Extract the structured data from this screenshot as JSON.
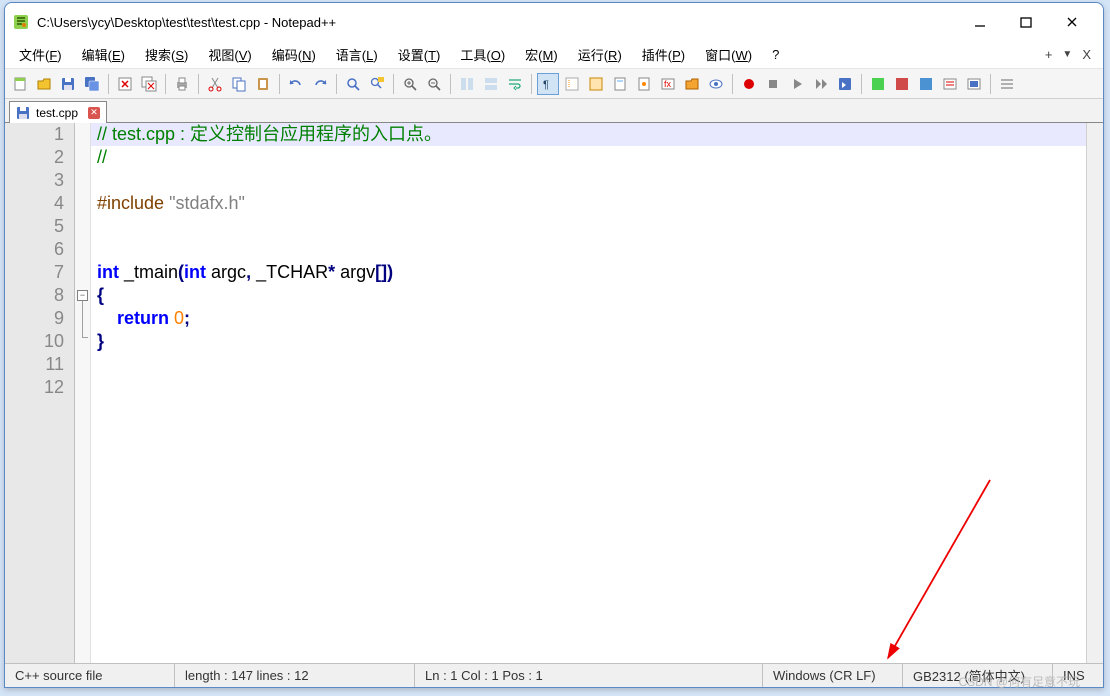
{
  "window": {
    "title": "C:\\Users\\ycy\\Desktop\\test\\test\\test.cpp - Notepad++"
  },
  "menus": [
    {
      "label": "文件",
      "key": "F"
    },
    {
      "label": "编辑",
      "key": "E"
    },
    {
      "label": "搜索",
      "key": "S"
    },
    {
      "label": "视图",
      "key": "V"
    },
    {
      "label": "编码",
      "key": "N"
    },
    {
      "label": "语言",
      "key": "L"
    },
    {
      "label": "设置",
      "key": "T"
    },
    {
      "label": "工具",
      "key": "O"
    },
    {
      "label": "宏",
      "key": "M"
    },
    {
      "label": "运行",
      "key": "R"
    },
    {
      "label": "插件",
      "key": "P"
    },
    {
      "label": "窗口",
      "key": "W"
    },
    {
      "label": "?",
      "key": ""
    }
  ],
  "menuRight": {
    "plus": "+",
    "down": "▼",
    "x": "X"
  },
  "tab": {
    "name": "test.cpp"
  },
  "lineCount": 12,
  "code": {
    "l1_cmt": "// test.cpp : 定义控制台应用程序的入口点。",
    "l2_cmt": "//",
    "l4_pre": "#include ",
    "l4_str": "\"stdafx.h\"",
    "l7_kw1": "int",
    "l7_id": " _tmain",
    "l7_p1": "(",
    "l7_kw2": "int",
    "l7_sp1": " argc",
    "l7_cm": ",",
    "l7_sp2": " _TCHAR",
    "l7_op": "*",
    "l7_sp3": " argv",
    "l7_br": "[])",
    "l8": "{",
    "l9_kw": "    return ",
    "l9_num": "0",
    "l9_sc": ";",
    "l10": "}"
  },
  "status": {
    "lang": "C++ source file",
    "len": "length : 147    lines : 12",
    "pos": "Ln : 1    Col : 1    Pos : 1",
    "eol": "Windows (CR LF)",
    "enc": "GB2312 (简体中文)",
    "ins": "INS"
  },
  "watermark": "CSDN @何有足意不玩"
}
